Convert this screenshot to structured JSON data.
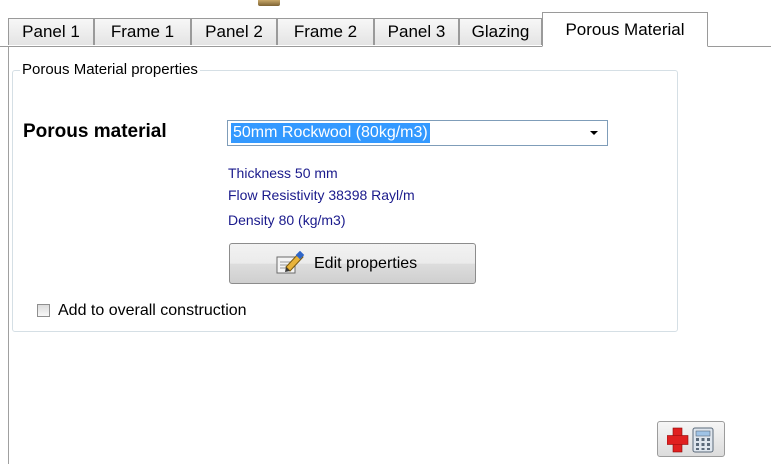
{
  "tabs": [
    {
      "label": "Panel 1"
    },
    {
      "label": "Frame 1"
    },
    {
      "label": "Panel 2"
    },
    {
      "label": "Frame 2"
    },
    {
      "label": "Panel 3"
    },
    {
      "label": "Glazing"
    },
    {
      "label": "Porous Material",
      "active": true
    }
  ],
  "group": {
    "title": "Porous Material properties"
  },
  "porous": {
    "label": "Porous material",
    "selected": "50mm Rockwool (80kg/m3)",
    "thickness": "Thickness  50 mm",
    "flow_resistivity": "Flow Resistivity  38398 Rayl/m",
    "density": "Density  80 (kg/m3)"
  },
  "edit_button": {
    "label": "Edit properties",
    "icon": "edit-properties-icon"
  },
  "add_checkbox": {
    "label": "Add to overall construction",
    "checked": false
  },
  "calc_button": {
    "icon": "add-calculator-icon"
  },
  "colors": {
    "selection": "#3399ff",
    "property_text": "#1a1a8c",
    "plus_red": "#e02020"
  }
}
